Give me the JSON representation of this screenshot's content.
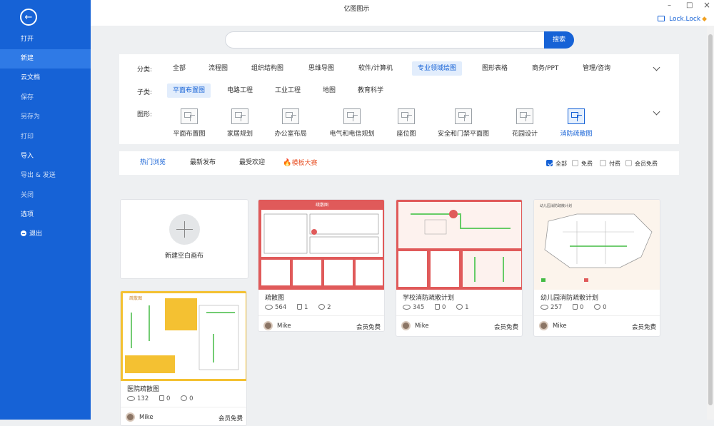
{
  "window": {
    "title": "亿图图示",
    "account": "Lock.Lock",
    "minimize": "–",
    "maximize": "□",
    "close": "×"
  },
  "sidebar": {
    "back_icon": "arrow-left-icon",
    "items": [
      {
        "label": "打开"
      },
      {
        "label": "新建"
      },
      {
        "label": "云文档"
      },
      {
        "label": "保存"
      },
      {
        "label": "另存为"
      },
      {
        "label": "打印"
      },
      {
        "label": "导入"
      },
      {
        "label": "导出 & 发送"
      },
      {
        "label": "关闭"
      },
      {
        "label": "选项"
      },
      {
        "label": "退出"
      }
    ]
  },
  "search": {
    "placeholder": "",
    "button": "搜索"
  },
  "filters": {
    "category_label": "分类:",
    "categories": [
      "全部",
      "流程图",
      "组织结构图",
      "思维导图",
      "软件/计算机",
      "专业领域绘图",
      "图形表格",
      "商务/PPT",
      "管理/咨询"
    ],
    "subcategory_label": "子类:",
    "subcategories": [
      "平面布置图",
      "电路工程",
      "工业工程",
      "地图",
      "教育科学"
    ],
    "shape_label": "图形:",
    "shapes": [
      "平面布置图",
      "家居规划",
      "办公室布局",
      "电气和电信规划",
      "座位图",
      "安全和门禁平面图",
      "花园设计",
      "消防疏散图"
    ]
  },
  "tabs": [
    "热门浏览",
    "最新发布",
    "最受欢迎",
    "模板大赛"
  ],
  "checkboxes": [
    {
      "label": "全部",
      "checked": true
    },
    {
      "label": "免费",
      "checked": false
    },
    {
      "label": "付费",
      "checked": false
    },
    {
      "label": "会员免费",
      "checked": false
    }
  ],
  "new_card": {
    "label": "新建空白画布"
  },
  "cards": [
    {
      "title": "疏散图",
      "views": "564",
      "likes": "1",
      "comments": "2",
      "author": "Mike",
      "badge": "会员免费",
      "thumb_text": "疏散图"
    },
    {
      "title": "学校消防疏散计划",
      "views": "345",
      "likes": "0",
      "comments": "1",
      "author": "Mike",
      "badge": "会员免费",
      "thumb_text": ""
    },
    {
      "title": "幼儿园消防疏散计划",
      "views": "257",
      "likes": "0",
      "comments": "0",
      "author": "Mike",
      "badge": "会员免费",
      "thumb_text": "幼儿园消防疏散计划"
    },
    {
      "title": "医院疏散图",
      "views": "132",
      "likes": "0",
      "comments": "0",
      "author": "Mike",
      "badge": "会员免费",
      "thumb_text": "疏散图"
    }
  ],
  "colors": {
    "brand": "#1662d6",
    "accent": "#e8542a",
    "thumb_red": "#e05a5a",
    "thumb_yellow": "#f4c132"
  }
}
